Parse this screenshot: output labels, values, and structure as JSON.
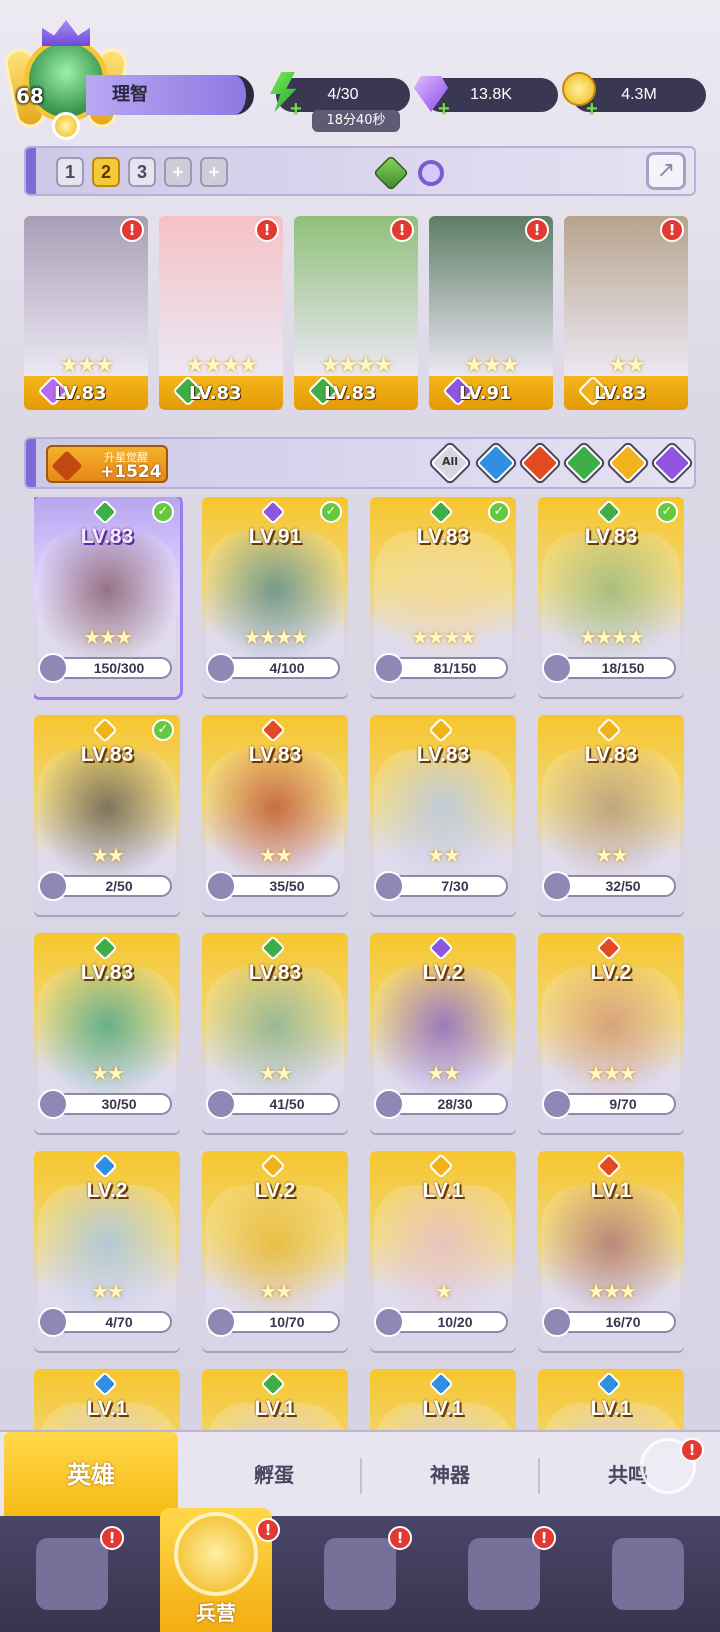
{
  "player": {
    "level": "68",
    "name": "理智"
  },
  "resources": {
    "energy": "4/30",
    "energy_timer": "18分40秒",
    "gems": "13.8K",
    "gold": "4.3M"
  },
  "team_tabs": [
    "1",
    "2",
    "3",
    "+",
    "+"
  ],
  "active_team": "2",
  "team_slots": [
    {
      "level": "LV.83",
      "element": "rainbow",
      "stars": "★★★",
      "color": "#a89fb6"
    },
    {
      "level": "LV.83",
      "element": "nature",
      "stars": "★★★★",
      "color": "#f4c2c6"
    },
    {
      "level": "LV.83",
      "element": "nature",
      "stars": "★★★★",
      "color": "#8fc07a"
    },
    {
      "level": "LV.91",
      "element": "dark",
      "stars": "★★★",
      "color": "#5e7e64"
    },
    {
      "level": "LV.83",
      "element": "light",
      "stars": "★★",
      "color": "#b7a48c"
    }
  ],
  "awaken": {
    "title": "升星觉醒",
    "value": "+1524"
  },
  "filters": {
    "all_label": "All"
  },
  "elements": {
    "rainbow": "#b46cf0",
    "nature": "#3fae46",
    "dark": "#8e55e0",
    "light": "#f0b31c",
    "fire": "#e34a22",
    "water": "#2f8fe0"
  },
  "heroes": [
    {
      "level": "LV.83",
      "element": "nature",
      "stars": "★★★",
      "progress": "150/300",
      "checked": true,
      "selected": true,
      "color": "#8a6070"
    },
    {
      "level": "LV.91",
      "element": "dark",
      "stars": "★★★★",
      "progress": "4/100",
      "checked": true,
      "color": "#5f8f8e"
    },
    {
      "level": "LV.83",
      "element": "nature",
      "stars": "★★★★",
      "progress": "81/150",
      "checked": true,
      "color": "#f5d9a0"
    },
    {
      "level": "LV.83",
      "element": "nature",
      "stars": "★★★★",
      "progress": "18/150",
      "checked": true,
      "color": "#9dbb7f"
    },
    {
      "level": "LV.83",
      "element": "light",
      "stars": "★★",
      "progress": "2/50",
      "checked": true,
      "color": "#6b6355"
    },
    {
      "level": "LV.83",
      "element": "fire",
      "stars": "★★",
      "progress": "35/50",
      "color": "#c05a3a"
    },
    {
      "level": "LV.83",
      "element": "light",
      "stars": "★★",
      "progress": "7/30",
      "color": "#b8c8e8"
    },
    {
      "level": "LV.83",
      "element": "light",
      "stars": "★★",
      "progress": "32/50",
      "color": "#b99d7e"
    },
    {
      "level": "LV.83",
      "element": "nature",
      "stars": "★★",
      "progress": "30/50",
      "color": "#4fa98a"
    },
    {
      "level": "LV.83",
      "element": "nature",
      "stars": "★★",
      "progress": "41/50",
      "color": "#8ab39a"
    },
    {
      "level": "LV.2",
      "element": "dark",
      "stars": "★★",
      "progress": "28/30",
      "color": "#8d6ac8"
    },
    {
      "level": "LV.2",
      "element": "fire",
      "stars": "★★★",
      "progress": "9/70",
      "color": "#d49a7a"
    },
    {
      "level": "LV.2",
      "element": "water",
      "stars": "★★",
      "progress": "4/70",
      "color": "#a8c6e8"
    },
    {
      "level": "LV.2",
      "element": "light",
      "stars": "★★",
      "progress": "10/70",
      "color": "#e7b93c"
    },
    {
      "level": "LV.1",
      "element": "light",
      "stars": "★",
      "progress": "10/20",
      "color": "#e8c0c8"
    },
    {
      "level": "LV.1",
      "element": "fire",
      "stars": "★★★",
      "progress": "16/70",
      "color": "#b07a7a"
    },
    {
      "level": "LV.1",
      "element": "water",
      "stars": "",
      "progress": "",
      "color": "#d6d0e2"
    },
    {
      "level": "LV.1",
      "element": "nature",
      "stars": "",
      "progress": "",
      "color": "#d6d0e2"
    },
    {
      "level": "LV.1",
      "element": "water",
      "stars": "",
      "progress": "",
      "color": "#d6d0e2"
    },
    {
      "level": "LV.1",
      "element": "water",
      "stars": "",
      "progress": "",
      "color": "#d6d0e2"
    }
  ],
  "subtabs": [
    "英雄",
    "孵蛋",
    "神器",
    "共鸣"
  ],
  "bottom_nav": [
    "",
    "兵营",
    "",
    "",
    ""
  ]
}
